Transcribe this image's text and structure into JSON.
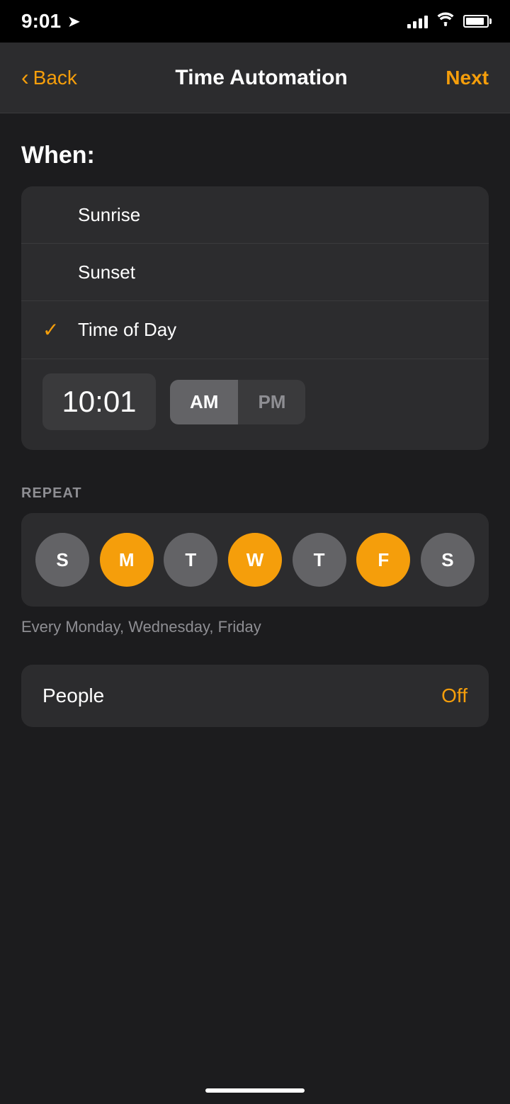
{
  "status": {
    "time": "9:01",
    "has_location": true
  },
  "nav": {
    "back_label": "Back",
    "title": "Time Automation",
    "next_label": "Next"
  },
  "when": {
    "section_label": "When:",
    "options": [
      {
        "id": "sunrise",
        "label": "Sunrise",
        "selected": false
      },
      {
        "id": "sunset",
        "label": "Sunset",
        "selected": false
      },
      {
        "id": "time_of_day",
        "label": "Time of Day",
        "selected": true
      }
    ],
    "time_value": "10:01",
    "am_selected": true,
    "am_label": "AM",
    "pm_label": "PM"
  },
  "repeat": {
    "section_label": "REPEAT",
    "days": [
      {
        "label": "S",
        "id": "sunday",
        "selected": false
      },
      {
        "label": "M",
        "id": "monday",
        "selected": true
      },
      {
        "label": "T",
        "id": "tuesday",
        "selected": false
      },
      {
        "label": "W",
        "id": "wednesday",
        "selected": true
      },
      {
        "label": "T",
        "id": "thursday",
        "selected": false
      },
      {
        "label": "F",
        "id": "friday",
        "selected": true
      },
      {
        "label": "S",
        "id": "saturday",
        "selected": false
      }
    ],
    "description": "Every Monday, Wednesday, Friday"
  },
  "people": {
    "label": "People",
    "value": "Off"
  },
  "colors": {
    "accent": "#f59e0b",
    "background": "#1c1c1e",
    "card_bg": "#2c2c2e",
    "selected_day": "#f59e0b",
    "unselected_day": "#636366"
  }
}
